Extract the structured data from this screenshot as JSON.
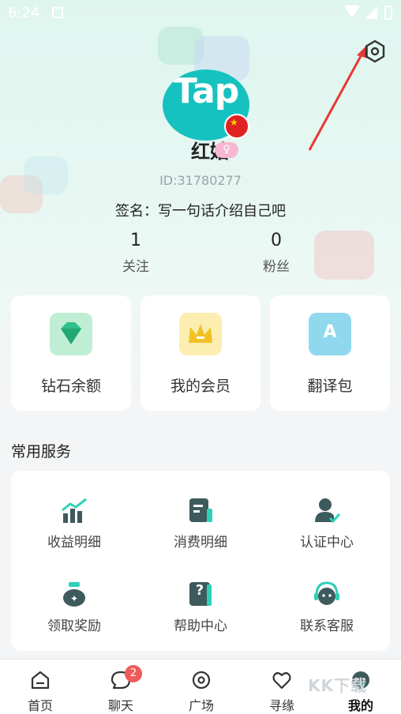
{
  "status_bar": {
    "time": "6:24"
  },
  "profile": {
    "avatar_text": "Tap",
    "username": "红姑",
    "user_id": "ID:31780277",
    "signature": "签名：写一句话介绍自己吧",
    "following_count": "1",
    "following_label": "关注",
    "followers_count": "0",
    "followers_label": "粉丝"
  },
  "cards": [
    {
      "label": "钻石余额",
      "icon": "diamond-icon"
    },
    {
      "label": "我的会员",
      "icon": "crown-icon"
    },
    {
      "label": "翻译包",
      "icon": "translate-icon",
      "icon_text": "A"
    }
  ],
  "services": {
    "title": "常用服务",
    "items": [
      {
        "label": "收益明细",
        "icon": "chart-icon"
      },
      {
        "label": "消费明细",
        "icon": "bill-icon"
      },
      {
        "label": "认证中心",
        "icon": "verified-user-icon"
      },
      {
        "label": "领取奖励",
        "icon": "money-bag-icon"
      },
      {
        "label": "帮助中心",
        "icon": "help-icon",
        "icon_text": "?"
      },
      {
        "label": "联系客服",
        "icon": "headset-icon"
      }
    ]
  },
  "tabbar": {
    "tabs": [
      {
        "label": "首页",
        "icon": "home-icon"
      },
      {
        "label": "聊天",
        "icon": "chat-icon",
        "badge": "2"
      },
      {
        "label": "广场",
        "icon": "plaza-icon"
      },
      {
        "label": "寻缘",
        "icon": "heart-icon"
      },
      {
        "label": "我的",
        "icon": "profile-icon",
        "active": true
      }
    ]
  },
  "watermark": "KK下载",
  "colors": {
    "accent": "#16c2c0",
    "badge": "#f05a5a",
    "icon_dark": "#3d5a5c",
    "icon_accent": "#2fd0b9"
  }
}
